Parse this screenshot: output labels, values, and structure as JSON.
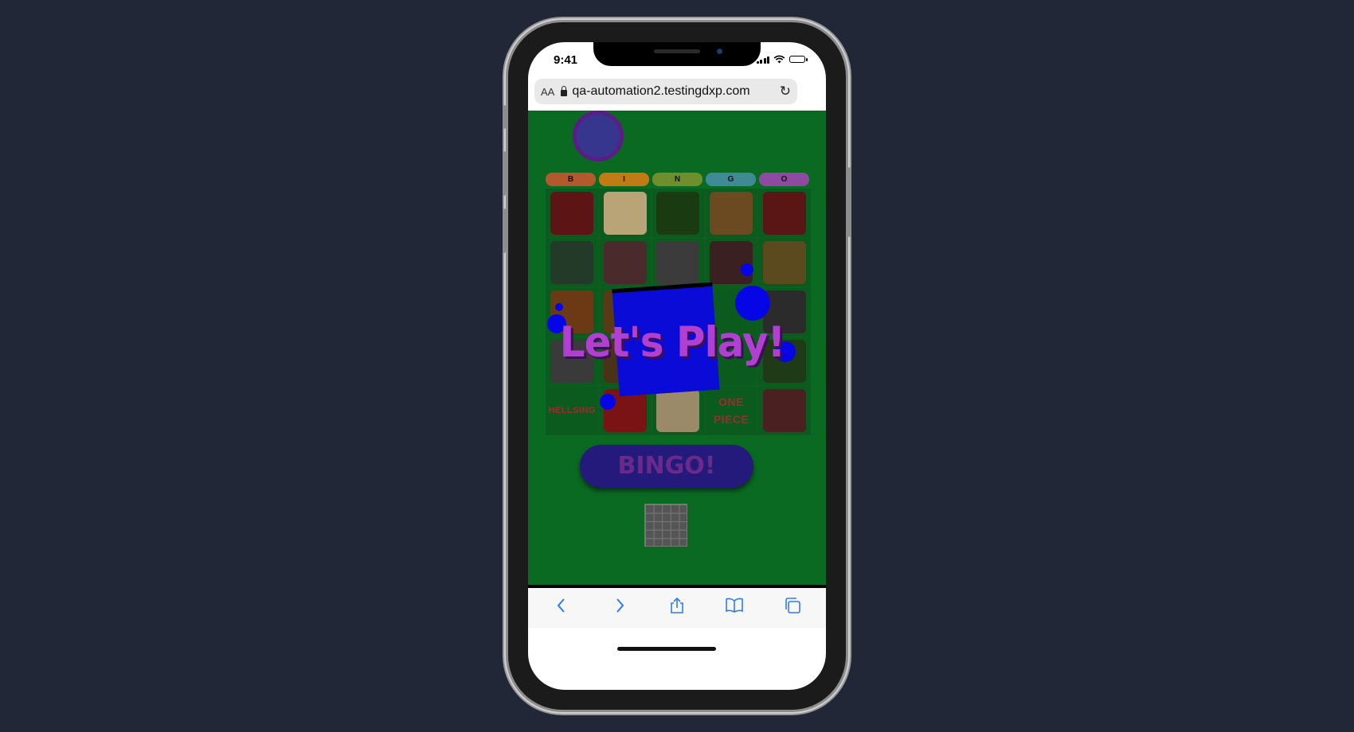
{
  "status": {
    "time": "9:41"
  },
  "browser": {
    "text_size_label": "AA",
    "url": "qa-automation2.testingdxp.com",
    "reload_icon": "reload-icon"
  },
  "game": {
    "letters": [
      {
        "label": "B",
        "color": "#b4582d"
      },
      {
        "label": "I",
        "color": "#c07b12"
      },
      {
        "label": "N",
        "color": "#6f8f2c"
      },
      {
        "label": "G",
        "color": "#3f8b95"
      },
      {
        "label": "O",
        "color": "#8e4aa0"
      }
    ],
    "cells": [
      {
        "kind": "image",
        "name": "hellsing-character-image",
        "color": "#5c1414"
      },
      {
        "kind": "image",
        "name": "soda-can-image",
        "color": "#b9a478"
      },
      {
        "kind": "image",
        "name": "green-leaf-image",
        "color": "#1a3a12"
      },
      {
        "kind": "image",
        "name": "one-piece-crew-image",
        "color": "#6b4a22"
      },
      {
        "kind": "image",
        "name": "red-character-image",
        "color": "#5a1515"
      },
      {
        "kind": "image",
        "name": "masked-character-image",
        "color": "#243a28"
      },
      {
        "kind": "image",
        "name": "luffy-image",
        "color": "#4a2a2a"
      },
      {
        "kind": "image",
        "name": "gta-san-andreas-logo-image",
        "color": "#3b3b3b"
      },
      {
        "kind": "image",
        "name": "pepsi-bottle-image",
        "color": "#3a2020"
      },
      {
        "kind": "image",
        "name": "straw-hat-luffy-image",
        "color": "#5a4a1e"
      },
      {
        "kind": "image",
        "name": "burger-image",
        "color": "#6b3a14"
      },
      {
        "kind": "image",
        "name": "one-piece-logo-image",
        "color": "#5a3a12"
      },
      {
        "kind": "image",
        "name": "free-space-image",
        "color": "#0b5a1e"
      },
      {
        "kind": "image",
        "name": "hidden-cell-image",
        "color": "#0b5a1e"
      },
      {
        "kind": "image",
        "name": "gta-v-logo-image",
        "color": "#2b2b2b"
      },
      {
        "kind": "image",
        "name": "one-piece-title-image",
        "color": "#3a3a3a"
      },
      {
        "kind": "image",
        "name": "brown-cell-image",
        "color": "#4a3216"
      },
      {
        "kind": "image",
        "name": "hidden-cell-image-2",
        "color": "#0b5a1e"
      },
      {
        "kind": "image",
        "name": "hidden-cell-image-3",
        "color": "#0b5a1e"
      },
      {
        "kind": "image",
        "name": "green-teeth-image",
        "color": "#1f3a16"
      },
      {
        "kind": "text",
        "text": "HELLSING"
      },
      {
        "kind": "image",
        "name": "red-apple-image",
        "color": "#7a1414"
      },
      {
        "kind": "image",
        "name": "cola-can-image",
        "color": "#9a8a6a"
      },
      {
        "kind": "text",
        "text": "ONE PIECE"
      },
      {
        "kind": "image",
        "name": "luffy-running-image",
        "color": "#4a2020"
      }
    ],
    "overlay_title": "Let's Play!",
    "bingo_label": "BINGO!"
  },
  "toolbar": {
    "items": [
      "back-icon",
      "forward-icon",
      "share-icon",
      "bookmarks-icon",
      "tabs-icon"
    ]
  }
}
